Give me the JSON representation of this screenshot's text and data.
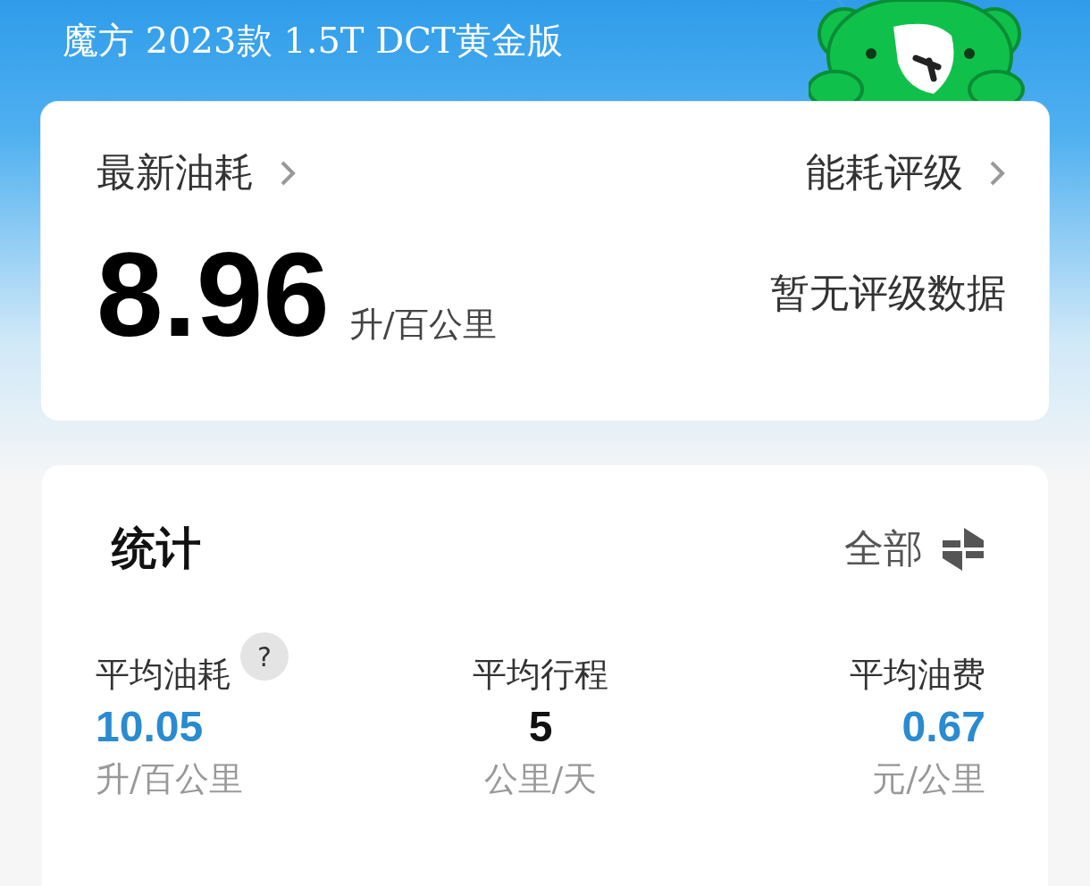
{
  "header": {
    "title": "魔方 2023款 1.5T DCT黄金版"
  },
  "fuel_card": {
    "latest_label": "最新油耗",
    "latest_value": "8.96",
    "latest_unit": "升/百公里",
    "rating_label": "能耗评级",
    "rating_value": "暂无评级数据"
  },
  "stats": {
    "title": "统计",
    "filter": "全部",
    "items": [
      {
        "label": "平均油耗",
        "help": "?",
        "value": "10.05",
        "unit": "升/百公里",
        "color": "#2a8bd0"
      },
      {
        "label": "平均行程",
        "value": "5",
        "unit": "公里/天",
        "color": "#111111"
      },
      {
        "label": "平均油费",
        "value": "0.67",
        "unit": "元/公里",
        "color": "#2a8bd0"
      }
    ]
  }
}
